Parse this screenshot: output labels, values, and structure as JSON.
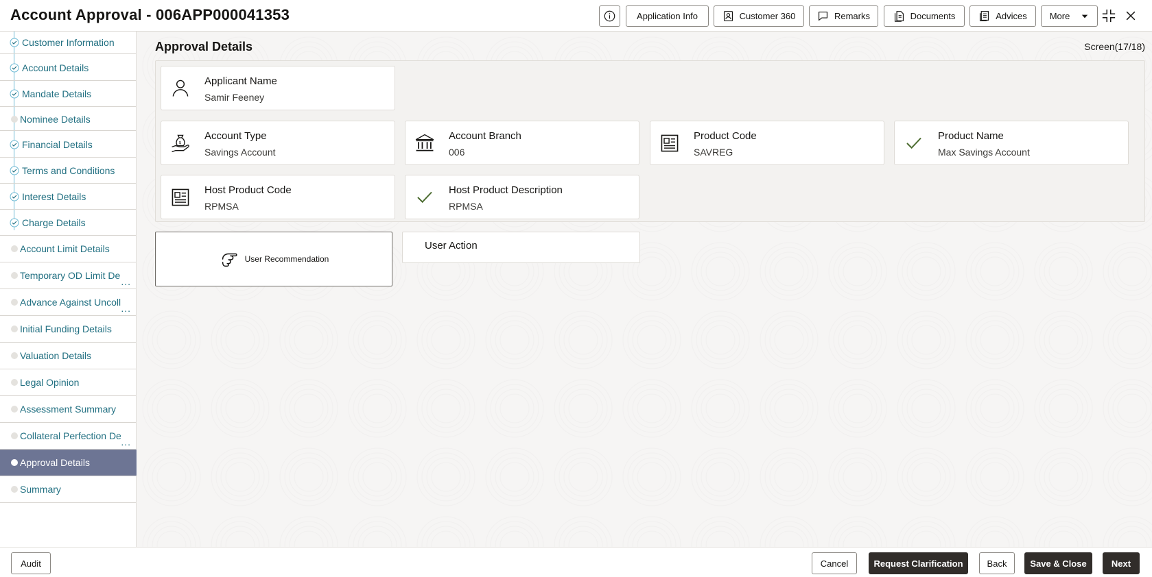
{
  "header": {
    "title": "Account Approval - 006APP000041353",
    "buttons": {
      "application_info": "Application Info",
      "customer_360": "Customer 360",
      "remarks": "Remarks",
      "documents": "Documents",
      "advices": "Advices",
      "more": "More"
    }
  },
  "sidebar": {
    "items": [
      {
        "label": "Customer Information",
        "status": "completed"
      },
      {
        "label": "Account Details",
        "status": "completed"
      },
      {
        "label": "Mandate Details",
        "status": "completed"
      },
      {
        "label": "Nominee Details",
        "status": "pending"
      },
      {
        "label": "Financial Details",
        "status": "completed"
      },
      {
        "label": "Terms and Conditions",
        "status": "completed"
      },
      {
        "label": "Interest Details",
        "status": "completed"
      },
      {
        "label": "Charge Details",
        "status": "completed"
      },
      {
        "label": "Account Limit Details",
        "status": "pending"
      },
      {
        "label": "Temporary OD Limit De",
        "status": "pending",
        "truncated": true
      },
      {
        "label": "Advance Against Uncoll",
        "status": "pending",
        "truncated": true
      },
      {
        "label": "Initial Funding Details",
        "status": "pending"
      },
      {
        "label": "Valuation Details",
        "status": "pending"
      },
      {
        "label": "Legal Opinion",
        "status": "pending"
      },
      {
        "label": "Assessment Summary",
        "status": "pending"
      },
      {
        "label": "Collateral Perfection De",
        "status": "pending",
        "truncated": true
      },
      {
        "label": "Approval Details",
        "status": "active"
      },
      {
        "label": "Summary",
        "status": "pending"
      }
    ],
    "ellipsis": "..."
  },
  "main": {
    "section_title": "Approval Details",
    "screen_count": "Screen(17/18)",
    "fields": {
      "applicant_name": {
        "label": "Applicant Name",
        "value": "Samir Feeney",
        "icon": "person-icon"
      },
      "account_type": {
        "label": "Account Type",
        "value": "Savings Account",
        "icon": "money-bag-hand-icon"
      },
      "account_branch": {
        "label": "Account Branch",
        "value": "006",
        "icon": "bank-icon"
      },
      "product_code": {
        "label": "Product Code",
        "value": "SAVREG",
        "icon": "newspaper-icon"
      },
      "product_name": {
        "label": "Product Name",
        "value": "Max Savings Account",
        "icon": "check-icon"
      },
      "host_product_code": {
        "label": "Host Product Code",
        "value": "RPMSA",
        "icon": "newspaper-icon"
      },
      "host_product_description": {
        "label": "Host Product Description",
        "value": "RPMSA",
        "icon": "check-icon"
      }
    },
    "user_recommendation": "User Recommendation",
    "user_action": "User Action"
  },
  "footer": {
    "audit": "Audit",
    "cancel": "Cancel",
    "request_clarification": "Request Clarification",
    "back": "Back",
    "save_close": "Save & Close",
    "next": "Next"
  },
  "colors": {
    "accent_link": "#227082",
    "active_nav": "#6d7594",
    "dark_button": "#312d2a",
    "check_green": "#4b6b2f"
  }
}
